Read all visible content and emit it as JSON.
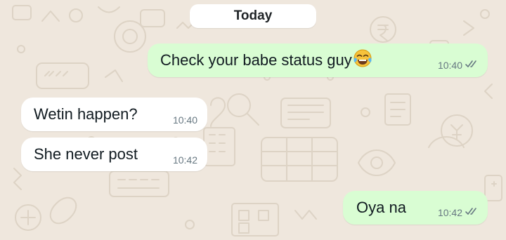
{
  "date_separator": "Today",
  "messages": [
    {
      "direction": "outgoing",
      "text": "Check your babe status guy",
      "emoji": "face-with-tears-of-joy",
      "time": "10:40",
      "status": "read"
    },
    {
      "direction": "incoming",
      "text": "Wetin happen?",
      "time": "10:40"
    },
    {
      "direction": "incoming",
      "text": "She never post",
      "time": "10:42"
    },
    {
      "direction": "outgoing",
      "text": "Oya na",
      "time": "10:42",
      "status": "read"
    }
  ],
  "colors": {
    "wallpaper": "#efe7dd",
    "outgoing_bubble": "#d9fdd3",
    "incoming_bubble": "#ffffff",
    "timestamp": "#667781",
    "message_text": "#111b21"
  }
}
